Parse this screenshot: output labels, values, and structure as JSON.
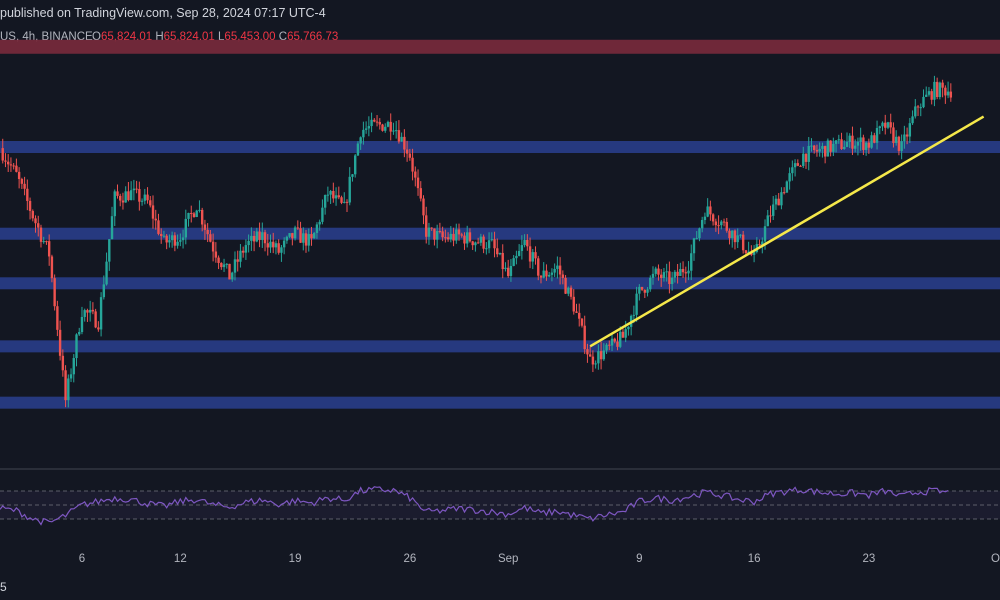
{
  "header": {
    "published_text": "published on TradingView.com, Sep 28, 2024 07:17 UTC-4"
  },
  "legend": {
    "symbol": "US, 4h, BINANCE",
    "open_label": "O",
    "open_value": "65,824.01",
    "high_label": "H",
    "high_value": "65,824.01",
    "low_label": "L",
    "low_value": "65,453.00",
    "close_label": "C",
    "close_value": "65,766.73"
  },
  "footer": {
    "text": "5"
  },
  "colors": {
    "background": "#131722",
    "up_candle": "#26a69a",
    "down_candle": "#ef5350",
    "support_zone": "#2a3f8f",
    "resistance_zone": "#7a2a3c",
    "trendline": "#f5e84a",
    "rsi_line": "#7e57c2"
  },
  "chart_data": {
    "type": "candlestick",
    "timeframe": "4h",
    "x_tick_labels": [
      "6",
      "12",
      "19",
      "26",
      "Sep",
      "9",
      "16",
      "23",
      "Oct"
    ],
    "x_tick_dates": [
      "2024-08-06",
      "2024-08-12",
      "2024-08-19",
      "2024-08-26",
      "2024-09-01",
      "2024-09-09",
      "2024-09-16",
      "2024-09-23",
      "2024-10-01"
    ],
    "x_range": [
      "2024-08-01",
      "2024-10-01"
    ],
    "y_range": [
      49000,
      68000
    ],
    "price_path": [
      [
        "2024-08-01",
        63200
      ],
      [
        "2024-08-02",
        62000
      ],
      [
        "2024-08-03",
        60200
      ],
      [
        "2024-08-04",
        58500
      ],
      [
        "2024-08-05",
        52000
      ],
      [
        "2024-08-06",
        56000
      ],
      [
        "2024-08-07",
        55500
      ],
      [
        "2024-08-08",
        61000
      ],
      [
        "2024-08-09",
        61200
      ],
      [
        "2024-08-10",
        60800
      ],
      [
        "2024-08-11",
        59000
      ],
      [
        "2024-08-12",
        59300
      ],
      [
        "2024-08-13",
        60700
      ],
      [
        "2024-08-14",
        58800
      ],
      [
        "2024-08-15",
        57500
      ],
      [
        "2024-08-16",
        58900
      ],
      [
        "2024-08-17",
        59300
      ],
      [
        "2024-08-18",
        58600
      ],
      [
        "2024-08-19",
        59400
      ],
      [
        "2024-08-20",
        59000
      ],
      [
        "2024-08-21",
        61200
      ],
      [
        "2024-08-22",
        60500
      ],
      [
        "2024-08-23",
        64000
      ],
      [
        "2024-08-24",
        64200
      ],
      [
        "2024-08-25",
        64300
      ],
      [
        "2024-08-26",
        62900
      ],
      [
        "2024-08-27",
        59500
      ],
      [
        "2024-08-28",
        59200
      ],
      [
        "2024-08-29",
        59300
      ],
      [
        "2024-08-30",
        59100
      ],
      [
        "2024-08-31",
        58900
      ],
      [
        "2024-09-01",
        57500
      ],
      [
        "2024-09-02",
        59000
      ],
      [
        "2024-09-03",
        57500
      ],
      [
        "2024-09-04",
        57900
      ],
      [
        "2024-09-05",
        56200
      ],
      [
        "2024-09-06",
        53800
      ],
      [
        "2024-09-07",
        54200
      ],
      [
        "2024-09-08",
        54800
      ],
      [
        "2024-09-09",
        56800
      ],
      [
        "2024-09-10",
        57600
      ],
      [
        "2024-09-11",
        57300
      ],
      [
        "2024-09-12",
        58100
      ],
      [
        "2024-09-13",
        60500
      ],
      [
        "2024-09-14",
        59900
      ],
      [
        "2024-09-15",
        59200
      ],
      [
        "2024-09-16",
        58300
      ],
      [
        "2024-09-17",
        60300
      ],
      [
        "2024-09-18",
        61700
      ],
      [
        "2024-09-19",
        62900
      ],
      [
        "2024-09-20",
        63100
      ],
      [
        "2024-09-21",
        63300
      ],
      [
        "2024-09-22",
        63500
      ],
      [
        "2024-09-23",
        63400
      ],
      [
        "2024-09-24",
        64200
      ],
      [
        "2024-09-25",
        63200
      ],
      [
        "2024-09-26",
        65100
      ],
      [
        "2024-09-27",
        65800
      ],
      [
        "2024-09-28",
        65766.73
      ]
    ],
    "support_zones": [
      63250,
      59400,
      57200,
      54400,
      51900
    ],
    "resistance_zones": [
      67700
    ],
    "trendline": {
      "start": [
        "2024-09-06",
        54400
      ],
      "end": [
        "2024-09-30",
        64600
      ]
    },
    "rsi": {
      "bands": [
        70,
        50,
        30
      ],
      "values": [
        45,
        42,
        30,
        24,
        35,
        50,
        55,
        60,
        58,
        52,
        48,
        55,
        58,
        50,
        47,
        54,
        57,
        51,
        56,
        53,
        60,
        57,
        70,
        72,
        71,
        60,
        40,
        42,
        45,
        43,
        40,
        37,
        46,
        38,
        41,
        35,
        30,
        36,
        40,
        55,
        60,
        57,
        62,
        68,
        64,
        58,
        55,
        66,
        70,
        72,
        68,
        66,
        67,
        64,
        70,
        62,
        69,
        70,
        67
      ]
    }
  }
}
